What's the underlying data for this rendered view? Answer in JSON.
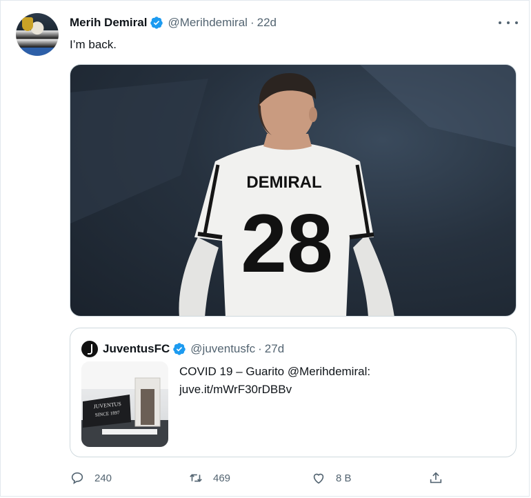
{
  "tweet": {
    "author_name": "Merih Demiral",
    "author_handle": "@Merihdemiral",
    "separator": "·",
    "time": "22d",
    "text": "I’m back.",
    "photo": {
      "shirt_name": "DEMIRAL",
      "shirt_number": "28"
    }
  },
  "quoted": {
    "author_name": "JuventusFC",
    "author_handle": "@juventusfc",
    "separator": "·",
    "time": "27d",
    "text_line1": "COVID 19 – Guarito @Merihdemiral:",
    "text_line2": "juve.it/mWrF30rDBBv",
    "thumb_sign_line1": "JUVENTUS",
    "thumb_sign_line2": "SINCE 1897"
  },
  "actions": {
    "reply_count": "240",
    "retweet_count": "469",
    "like_count": "8 B"
  },
  "icons": {
    "verified": "verified-badge-icon",
    "more": "more-options-icon",
    "reply": "reply-icon",
    "retweet": "retweet-icon",
    "like": "heart-icon",
    "share": "share-icon"
  },
  "colors": {
    "verified_blue": "#1d9bf0",
    "secondary_text": "#536471",
    "border": "#cfd9de"
  }
}
